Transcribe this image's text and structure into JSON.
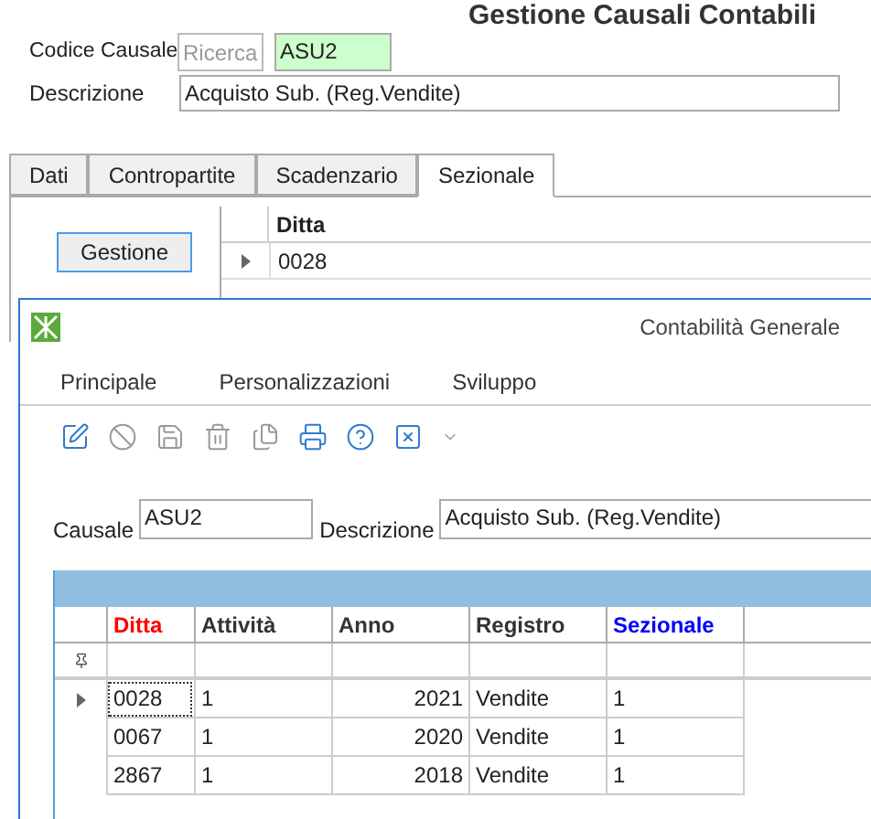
{
  "window": {
    "title": "Gestione Causali Contabili"
  },
  "form": {
    "codice_label": "Codice Causale",
    "search_placeholder": "Ricerca",
    "code_value": "ASU2",
    "descrizione_label": "Descrizione",
    "descrizione_value": "Acquisto Sub. (Reg.Vendite)"
  },
  "tabs": [
    {
      "label": "Dati",
      "selected": false
    },
    {
      "label": "Contropartite",
      "selected": false
    },
    {
      "label": "Scadenzario",
      "selected": false
    },
    {
      "label": "Sezionale",
      "selected": true
    }
  ],
  "gestione_button": "Gestione",
  "ditta_grid": {
    "column": "Ditta",
    "rows": [
      {
        "value": "0028",
        "current": true
      }
    ]
  },
  "dialog": {
    "title": "Contabilità Generale",
    "menu": [
      "Principale",
      "Personalizzazioni",
      "Sviluppo"
    ],
    "toolbar": [
      {
        "kind": "edit",
        "disabled": false
      },
      {
        "kind": "cancel",
        "disabled": true
      },
      {
        "kind": "save",
        "disabled": true
      },
      {
        "kind": "delete",
        "disabled": true
      },
      {
        "kind": "copy",
        "disabled": true
      },
      {
        "kind": "print",
        "disabled": false
      },
      {
        "kind": "help",
        "disabled": false
      },
      {
        "kind": "close",
        "disabled": false
      },
      {
        "kind": "more",
        "disabled": true
      }
    ],
    "causale_label": "Causale",
    "causale_value": "ASU2",
    "descrizione_label": "Descrizione",
    "descrizione_value": "Acquisto Sub. (Reg.Vendite)",
    "grid": {
      "columns": [
        {
          "label": "Ditta",
          "color": "#ff0000",
          "kind": "text"
        },
        {
          "label": "Attività",
          "color": "#333333",
          "kind": "text"
        },
        {
          "label": "Anno",
          "color": "#333333",
          "kind": "number"
        },
        {
          "label": "Registro",
          "color": "#333333",
          "kind": "text"
        },
        {
          "label": "Sezionale",
          "color": "#0000ff",
          "kind": "text"
        }
      ],
      "rows": [
        {
          "cells": [
            "0028",
            "1",
            "2021",
            "Vendite",
            "1"
          ],
          "current": true
        },
        {
          "cells": [
            "0067",
            "1",
            "2020",
            "Vendite",
            "1"
          ],
          "current": false
        },
        {
          "cells": [
            "2867",
            "1",
            "2018",
            "Vendite",
            "1"
          ],
          "current": false
        }
      ]
    }
  }
}
